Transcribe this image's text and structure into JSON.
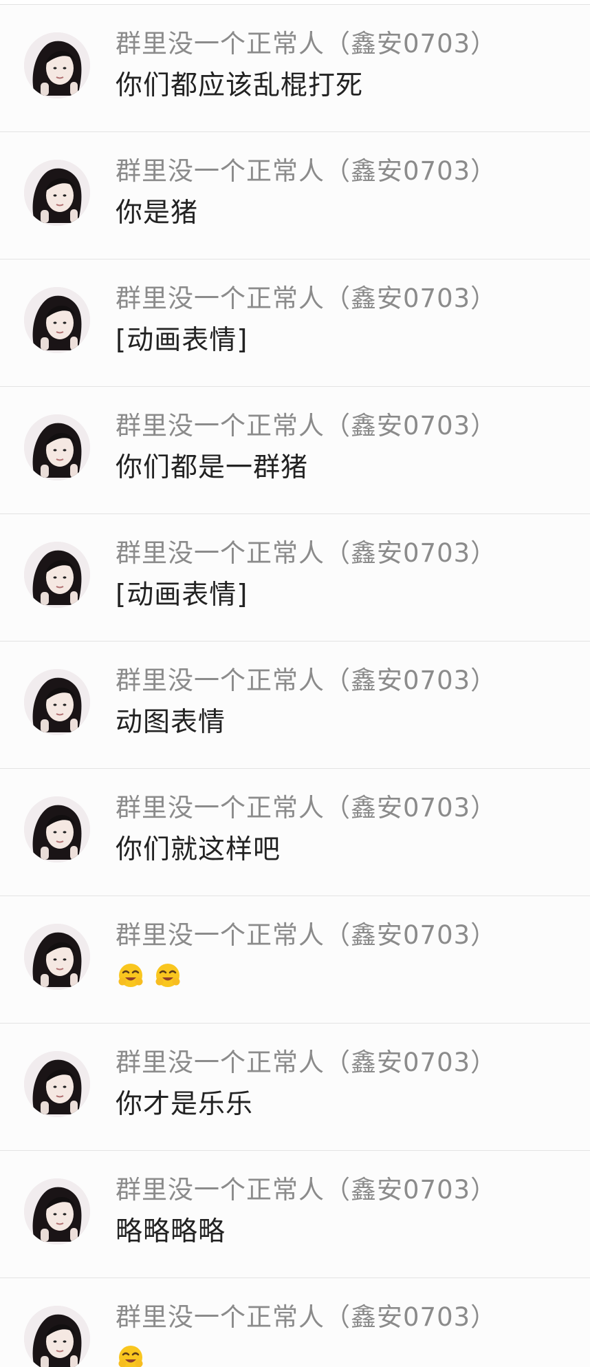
{
  "chat_list": {
    "messages": [
      {
        "sender": "群里没一个正常人（鑫安0703）",
        "text": "你们都应该乱棍打死"
      },
      {
        "sender": "群里没一个正常人（鑫安0703）",
        "text": "你是猪"
      },
      {
        "sender": "群里没一个正常人（鑫安0703）",
        "text": "[动画表情]"
      },
      {
        "sender": "群里没一个正常人（鑫安0703）",
        "text": "你们都是一群猪"
      },
      {
        "sender": "群里没一个正常人（鑫安0703）",
        "text": "[动画表情]"
      },
      {
        "sender": "群里没一个正常人（鑫安0703）",
        "text": "动图表情"
      },
      {
        "sender": "群里没一个正常人（鑫安0703）",
        "text": "你们就这样吧"
      },
      {
        "sender": "群里没一个正常人（鑫安0703）",
        "emoji": [
          "hug-emoji",
          "hug-emoji"
        ]
      },
      {
        "sender": "群里没一个正常人（鑫安0703）",
        "text": "你才是乐乐"
      },
      {
        "sender": "群里没一个正常人（鑫安0703）",
        "text": "略略略略"
      },
      {
        "sender": "群里没一个正常人（鑫安0703）",
        "emoji": [
          "hug-emoji"
        ]
      }
    ]
  },
  "colors": {
    "sender": "#8b8b8b",
    "text": "#222222",
    "divider": "#e3e3e3",
    "background": "#fcfcfc"
  }
}
